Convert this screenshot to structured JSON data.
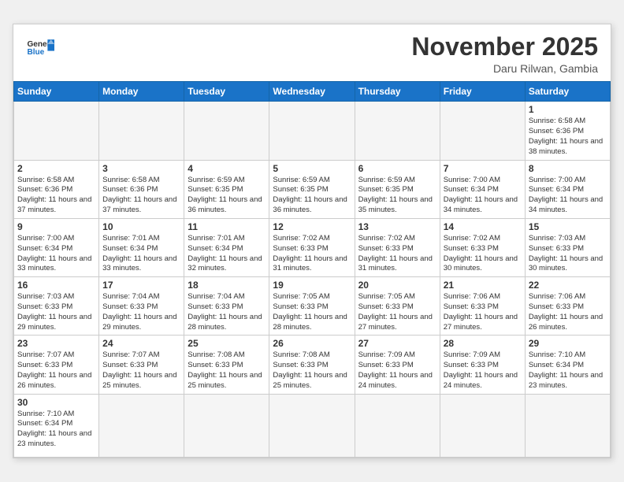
{
  "header": {
    "logo_general": "General",
    "logo_blue": "Blue",
    "month_title": "November 2025",
    "subtitle": "Daru Rilwan, Gambia"
  },
  "weekdays": [
    "Sunday",
    "Monday",
    "Tuesday",
    "Wednesday",
    "Thursday",
    "Friday",
    "Saturday"
  ],
  "weeks": [
    [
      {
        "day": "",
        "info": "",
        "empty": true
      },
      {
        "day": "",
        "info": "",
        "empty": true
      },
      {
        "day": "",
        "info": "",
        "empty": true
      },
      {
        "day": "",
        "info": "",
        "empty": true
      },
      {
        "day": "",
        "info": "",
        "empty": true
      },
      {
        "day": "",
        "info": "",
        "empty": true
      },
      {
        "day": "1",
        "info": "Sunrise: 6:58 AM\nSunset: 6:36 PM\nDaylight: 11 hours\nand 38 minutes.",
        "empty": false
      }
    ],
    [
      {
        "day": "2",
        "info": "Sunrise: 6:58 AM\nSunset: 6:36 PM\nDaylight: 11 hours\nand 37 minutes.",
        "empty": false
      },
      {
        "day": "3",
        "info": "Sunrise: 6:58 AM\nSunset: 6:36 PM\nDaylight: 11 hours\nand 37 minutes.",
        "empty": false
      },
      {
        "day": "4",
        "info": "Sunrise: 6:59 AM\nSunset: 6:35 PM\nDaylight: 11 hours\nand 36 minutes.",
        "empty": false
      },
      {
        "day": "5",
        "info": "Sunrise: 6:59 AM\nSunset: 6:35 PM\nDaylight: 11 hours\nand 36 minutes.",
        "empty": false
      },
      {
        "day": "6",
        "info": "Sunrise: 6:59 AM\nSunset: 6:35 PM\nDaylight: 11 hours\nand 35 minutes.",
        "empty": false
      },
      {
        "day": "7",
        "info": "Sunrise: 7:00 AM\nSunset: 6:34 PM\nDaylight: 11 hours\nand 34 minutes.",
        "empty": false
      },
      {
        "day": "8",
        "info": "Sunrise: 7:00 AM\nSunset: 6:34 PM\nDaylight: 11 hours\nand 34 minutes.",
        "empty": false
      }
    ],
    [
      {
        "day": "9",
        "info": "Sunrise: 7:00 AM\nSunset: 6:34 PM\nDaylight: 11 hours\nand 33 minutes.",
        "empty": false
      },
      {
        "day": "10",
        "info": "Sunrise: 7:01 AM\nSunset: 6:34 PM\nDaylight: 11 hours\nand 33 minutes.",
        "empty": false
      },
      {
        "day": "11",
        "info": "Sunrise: 7:01 AM\nSunset: 6:34 PM\nDaylight: 11 hours\nand 32 minutes.",
        "empty": false
      },
      {
        "day": "12",
        "info": "Sunrise: 7:02 AM\nSunset: 6:33 PM\nDaylight: 11 hours\nand 31 minutes.",
        "empty": false
      },
      {
        "day": "13",
        "info": "Sunrise: 7:02 AM\nSunset: 6:33 PM\nDaylight: 11 hours\nand 31 minutes.",
        "empty": false
      },
      {
        "day": "14",
        "info": "Sunrise: 7:02 AM\nSunset: 6:33 PM\nDaylight: 11 hours\nand 30 minutes.",
        "empty": false
      },
      {
        "day": "15",
        "info": "Sunrise: 7:03 AM\nSunset: 6:33 PM\nDaylight: 11 hours\nand 30 minutes.",
        "empty": false
      }
    ],
    [
      {
        "day": "16",
        "info": "Sunrise: 7:03 AM\nSunset: 6:33 PM\nDaylight: 11 hours\nand 29 minutes.",
        "empty": false
      },
      {
        "day": "17",
        "info": "Sunrise: 7:04 AM\nSunset: 6:33 PM\nDaylight: 11 hours\nand 29 minutes.",
        "empty": false
      },
      {
        "day": "18",
        "info": "Sunrise: 7:04 AM\nSunset: 6:33 PM\nDaylight: 11 hours\nand 28 minutes.",
        "empty": false
      },
      {
        "day": "19",
        "info": "Sunrise: 7:05 AM\nSunset: 6:33 PM\nDaylight: 11 hours\nand 28 minutes.",
        "empty": false
      },
      {
        "day": "20",
        "info": "Sunrise: 7:05 AM\nSunset: 6:33 PM\nDaylight: 11 hours\nand 27 minutes.",
        "empty": false
      },
      {
        "day": "21",
        "info": "Sunrise: 7:06 AM\nSunset: 6:33 PM\nDaylight: 11 hours\nand 27 minutes.",
        "empty": false
      },
      {
        "day": "22",
        "info": "Sunrise: 7:06 AM\nSunset: 6:33 PM\nDaylight: 11 hours\nand 26 minutes.",
        "empty": false
      }
    ],
    [
      {
        "day": "23",
        "info": "Sunrise: 7:07 AM\nSunset: 6:33 PM\nDaylight: 11 hours\nand 26 minutes.",
        "empty": false
      },
      {
        "day": "24",
        "info": "Sunrise: 7:07 AM\nSunset: 6:33 PM\nDaylight: 11 hours\nand 25 minutes.",
        "empty": false
      },
      {
        "day": "25",
        "info": "Sunrise: 7:08 AM\nSunset: 6:33 PM\nDaylight: 11 hours\nand 25 minutes.",
        "empty": false
      },
      {
        "day": "26",
        "info": "Sunrise: 7:08 AM\nSunset: 6:33 PM\nDaylight: 11 hours\nand 25 minutes.",
        "empty": false
      },
      {
        "day": "27",
        "info": "Sunrise: 7:09 AM\nSunset: 6:33 PM\nDaylight: 11 hours\nand 24 minutes.",
        "empty": false
      },
      {
        "day": "28",
        "info": "Sunrise: 7:09 AM\nSunset: 6:33 PM\nDaylight: 11 hours\nand 24 minutes.",
        "empty": false
      },
      {
        "day": "29",
        "info": "Sunrise: 7:10 AM\nSunset: 6:34 PM\nDaylight: 11 hours\nand 23 minutes.",
        "empty": false
      }
    ],
    [
      {
        "day": "30",
        "info": "Sunrise: 7:10 AM\nSunset: 6:34 PM\nDaylight: 11 hours\nand 23 minutes.",
        "empty": false
      },
      {
        "day": "",
        "info": "",
        "empty": true
      },
      {
        "day": "",
        "info": "",
        "empty": true
      },
      {
        "day": "",
        "info": "",
        "empty": true
      },
      {
        "day": "",
        "info": "",
        "empty": true
      },
      {
        "day": "",
        "info": "",
        "empty": true
      },
      {
        "day": "",
        "info": "",
        "empty": true
      }
    ]
  ]
}
